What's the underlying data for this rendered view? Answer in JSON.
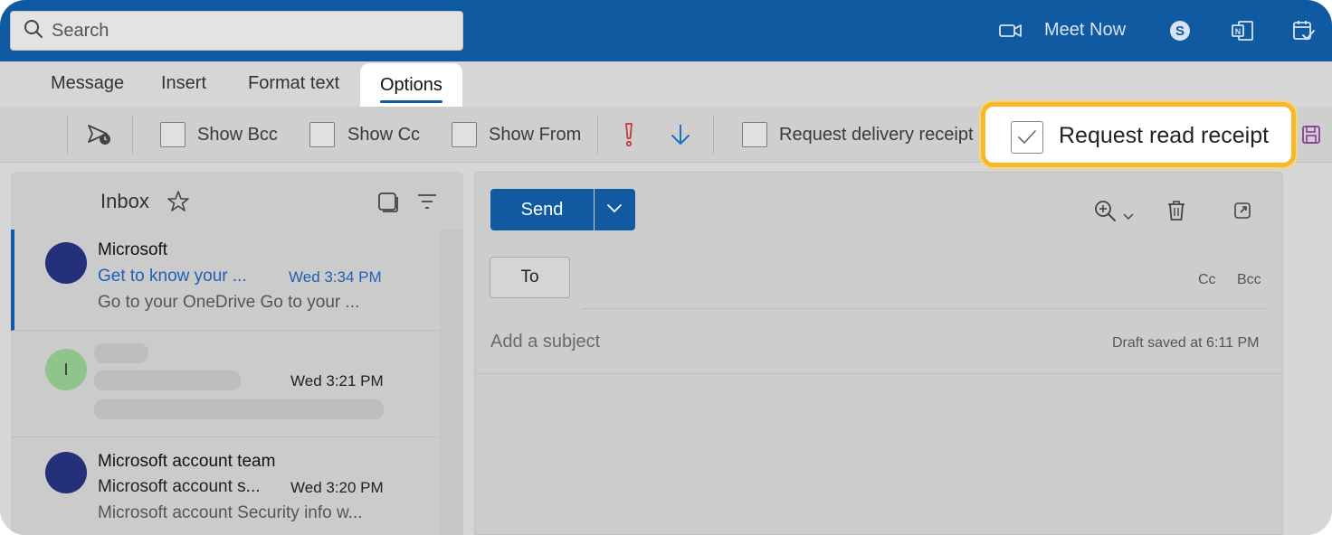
{
  "search": {
    "placeholder": "Search"
  },
  "topbar": {
    "meet_now_label": "Meet Now",
    "icons": [
      "video-camera-icon",
      "skype-icon",
      "office-app-icon",
      "calendar-check-icon"
    ]
  },
  "tabs": [
    {
      "label": "Message"
    },
    {
      "label": "Insert"
    },
    {
      "label": "Format text"
    },
    {
      "label": "Options",
      "active": true
    }
  ],
  "ribbon": {
    "show_bcc": "Show Bcc",
    "show_cc": "Show Cc",
    "show_from": "Show From",
    "request_delivery_receipt": "Request delivery receipt",
    "request_read_receipt": "Request read receipt",
    "read_receipt_checked": true,
    "highlight_color": "#f5b82e"
  },
  "inbox": {
    "title": "Inbox",
    "messages": [
      {
        "sender": "Microsoft",
        "subject": "Get to know your ...",
        "time": "Wed 3:34 PM",
        "preview": "Go to your OneDrive Go to your ...",
        "avatar_color": "#25307a",
        "selected": true
      },
      {
        "avatar_initial": "I",
        "time": "Wed 3:21 PM",
        "avatar_color": "#8fc58a"
      },
      {
        "sender": "Microsoft account team",
        "subject": "Microsoft account s...",
        "time": "Wed 3:20 PM",
        "preview": "Microsoft account Security info w...",
        "avatar_color": "#25307a"
      }
    ]
  },
  "compose": {
    "send_label": "Send",
    "to_label": "To",
    "cc_label": "Cc",
    "bcc_label": "Bcc",
    "subject_placeholder": "Add a subject",
    "draft_status": "Draft saved at 6:11 PM"
  },
  "colors": {
    "brand": "#0f5aa0",
    "link": "#1f5fb5"
  }
}
